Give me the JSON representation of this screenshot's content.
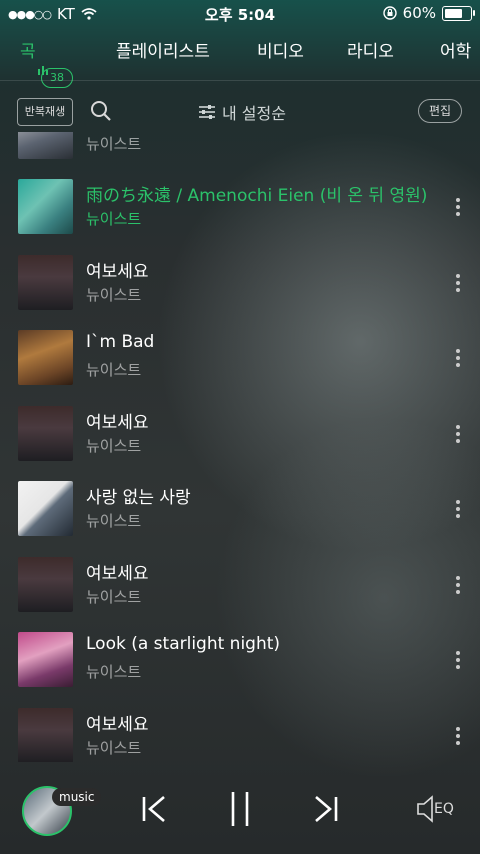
{
  "status": {
    "carrier": "KT",
    "time": "오후 5:04",
    "battery": "60%"
  },
  "tabs": [
    {
      "label": "곡",
      "badge": "38"
    },
    {
      "label": "플레이리스트"
    },
    {
      "label": "비디오"
    },
    {
      "label": "라디오"
    },
    {
      "label": "어학"
    }
  ],
  "toolbar": {
    "repeat_label": "반복재생",
    "sort_label": "내 설정순",
    "edit_label": "편집"
  },
  "songs": [
    {
      "title": "",
      "artist": "뉴이스트"
    },
    {
      "title": "雨のち永遠 / Amenochi Eien (비 온 뒤 영원)",
      "artist": "뉴이스트",
      "active": true
    },
    {
      "title": "여보세요",
      "artist": "뉴이스트"
    },
    {
      "title": "I`m Bad",
      "artist": "뉴이스트"
    },
    {
      "title": "여보세요",
      "artist": "뉴이스트"
    },
    {
      "title": "사랑 없는 사랑",
      "artist": "뉴이스트"
    },
    {
      "title": "여보세요",
      "artist": "뉴이스트"
    },
    {
      "title": "Look (a starlight night)",
      "artist": "뉴이스트"
    },
    {
      "title": "여보세요",
      "artist": "뉴이스트"
    }
  ],
  "player": {
    "label": "music",
    "eq_label": "EQ"
  },
  "colors": {
    "accent": "#2bc26a"
  }
}
